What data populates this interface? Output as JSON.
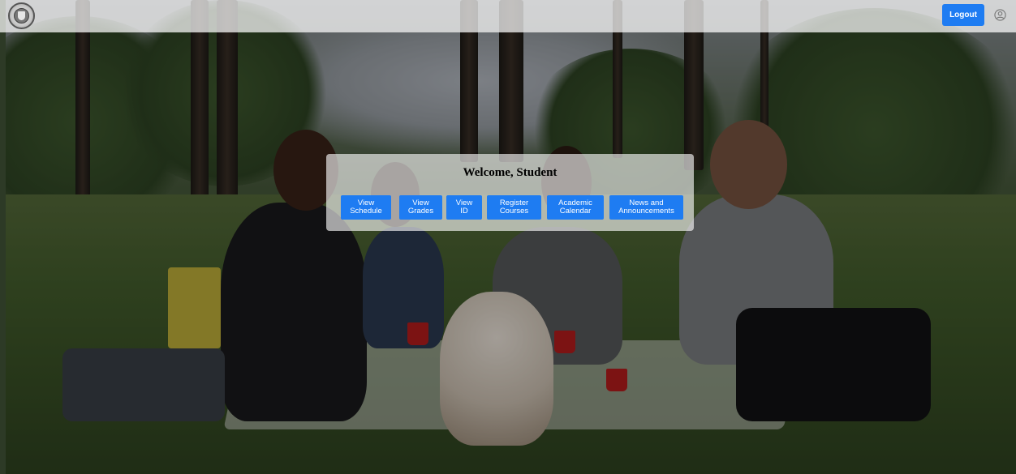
{
  "header": {
    "logo_icon": "university-seal-icon",
    "logout_label": "Logout",
    "user_icon": "user-circle-icon"
  },
  "welcome": {
    "title": "Welcome, Student",
    "buttons": [
      {
        "label": "View\nSchedule"
      },
      {
        "label": "View\nGrades"
      },
      {
        "label": "View\nID"
      },
      {
        "label": "Register\nCourses"
      },
      {
        "label": "Academic\nCalendar"
      },
      {
        "label": "News and\nAnnouncements"
      }
    ]
  },
  "colors": {
    "accent": "#1e7cf2"
  }
}
